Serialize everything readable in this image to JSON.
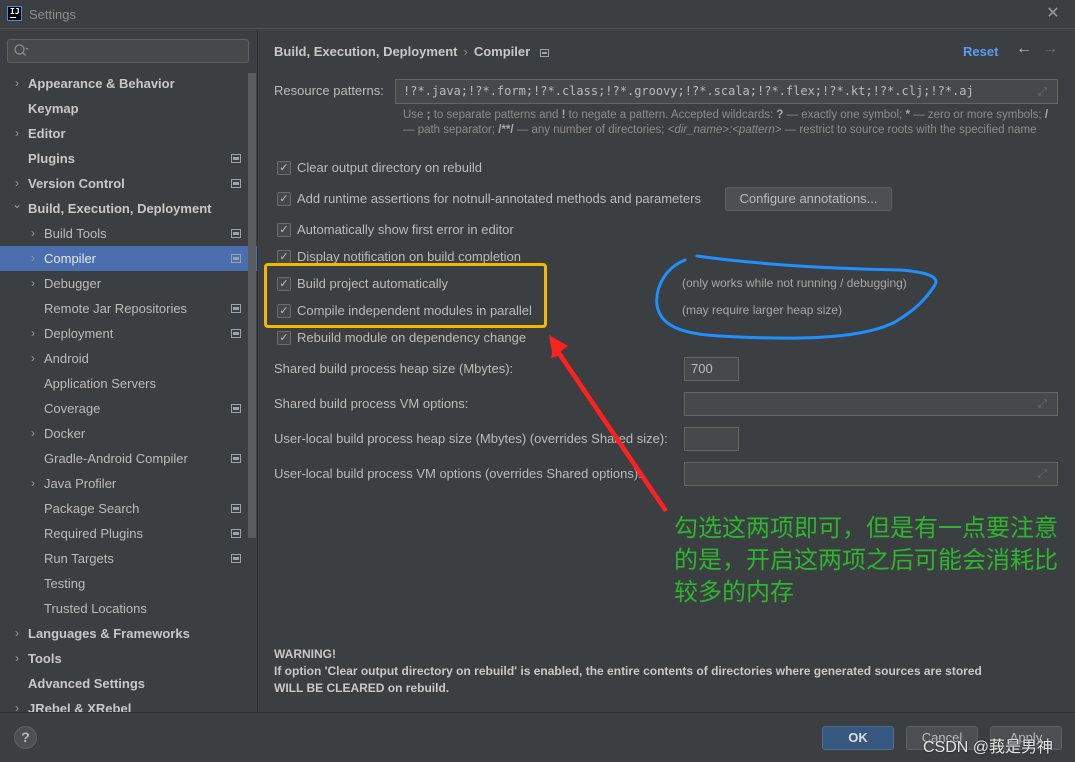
{
  "window": {
    "title": "Settings",
    "logo_text": "IJ"
  },
  "sidebar": {
    "search_placeholder": "",
    "items": [
      {
        "label": "Appearance & Behavior",
        "level": 0,
        "expandable": true,
        "expanded": false,
        "project_icon": false
      },
      {
        "label": "Keymap",
        "level": 0,
        "expandable": false,
        "project_icon": false
      },
      {
        "label": "Editor",
        "level": 0,
        "expandable": true,
        "expanded": false,
        "project_icon": false
      },
      {
        "label": "Plugins",
        "level": 0,
        "expandable": false,
        "project_icon": true
      },
      {
        "label": "Version Control",
        "level": 0,
        "expandable": true,
        "expanded": false,
        "project_icon": true
      },
      {
        "label": "Build, Execution, Deployment",
        "level": 0,
        "expandable": true,
        "expanded": true,
        "project_icon": false
      },
      {
        "label": "Build Tools",
        "level": 1,
        "expandable": true,
        "expanded": false,
        "project_icon": true
      },
      {
        "label": "Compiler",
        "level": 1,
        "expandable": true,
        "expanded": false,
        "project_icon": true,
        "selected": true
      },
      {
        "label": "Debugger",
        "level": 1,
        "expandable": true,
        "expanded": false,
        "project_icon": false
      },
      {
        "label": "Remote Jar Repositories",
        "level": 1,
        "expandable": false,
        "project_icon": true
      },
      {
        "label": "Deployment",
        "level": 1,
        "expandable": true,
        "expanded": false,
        "project_icon": true
      },
      {
        "label": "Android",
        "level": 1,
        "expandable": true,
        "expanded": false,
        "project_icon": false
      },
      {
        "label": "Application Servers",
        "level": 1,
        "expandable": false,
        "project_icon": false
      },
      {
        "label": "Coverage",
        "level": 1,
        "expandable": false,
        "project_icon": true
      },
      {
        "label": "Docker",
        "level": 1,
        "expandable": true,
        "expanded": false,
        "project_icon": false
      },
      {
        "label": "Gradle-Android Compiler",
        "level": 1,
        "expandable": false,
        "project_icon": true
      },
      {
        "label": "Java Profiler",
        "level": 1,
        "expandable": true,
        "expanded": false,
        "project_icon": false
      },
      {
        "label": "Package Search",
        "level": 1,
        "expandable": false,
        "project_icon": true
      },
      {
        "label": "Required Plugins",
        "level": 1,
        "expandable": false,
        "project_icon": true
      },
      {
        "label": "Run Targets",
        "level": 1,
        "expandable": false,
        "project_icon": true
      },
      {
        "label": "Testing",
        "level": 1,
        "expandable": false,
        "project_icon": false
      },
      {
        "label": "Trusted Locations",
        "level": 1,
        "expandable": false,
        "project_icon": false
      },
      {
        "label": "Languages & Frameworks",
        "level": 0,
        "expandable": true,
        "expanded": false,
        "project_icon": false
      },
      {
        "label": "Tools",
        "level": 0,
        "expandable": true,
        "expanded": false,
        "project_icon": false
      },
      {
        "label": "Advanced Settings",
        "level": 0,
        "expandable": false,
        "project_icon": false
      },
      {
        "label": "JRebel & XRebel",
        "level": 0,
        "expandable": true,
        "expanded": false,
        "project_icon": false
      }
    ]
  },
  "header": {
    "breadcrumb_parent": "Build, Execution, Deployment",
    "breadcrumb_separator": "›",
    "breadcrumb_current": "Compiler",
    "reset_label": "Reset",
    "back_icon": "←",
    "forward_icon": "→"
  },
  "resource_patterns": {
    "label": "Resource patterns:",
    "value": "!?*.java;!?*.form;!?*.class;!?*.groovy;!?*.scala;!?*.flex;!?*.kt;!?*.clj;!?*.aj",
    "help_parts": {
      "p1": "Use ",
      "semi": ";",
      "p2": " to separate patterns and ",
      "bang": "!",
      "p3": " to negate a pattern. Accepted wildcards: ",
      "q": "?",
      "p4": " — exactly one symbol; ",
      "star": "*",
      "p5": " — zero or more symbols; ",
      "slash": "/",
      "p6": " — path separator; ",
      "dstar": "/**/",
      "p7": " — any number of directories; ",
      "dir": "<dir_name>:<pattern>",
      "p8": " — restrict to source roots with the specified name"
    }
  },
  "checkboxes": [
    {
      "label": "Clear output directory on rebuild",
      "checked": true
    },
    {
      "label": "Add runtime assertions for notnull-annotated methods and parameters",
      "checked": true
    },
    {
      "label": "Automatically show first error in editor",
      "checked": true
    },
    {
      "label": "Display notification on build completion",
      "checked": true
    },
    {
      "label": "Build project automatically",
      "checked": true
    },
    {
      "label": "Compile independent modules in parallel",
      "checked": true
    },
    {
      "label": "Rebuild module on dependency change",
      "checked": true
    }
  ],
  "configure_annotations_label": "Configure annotations...",
  "hints": {
    "build_auto": "(only works while not running / debugging)",
    "parallel": "(may require larger heap size)"
  },
  "fields": {
    "shared_heap_label": "Shared build process heap size (Mbytes):",
    "shared_heap_value": "700",
    "shared_vm_label": "Shared build process VM options:",
    "shared_vm_value": "",
    "local_heap_label": "User-local build process heap size (Mbytes) (overrides Shared size):",
    "local_heap_value": "",
    "local_vm_label": "User-local build process VM options (overrides Shared options):",
    "local_vm_value": ""
  },
  "warning": {
    "title": "WARNING!",
    "line1": "If option 'Clear output directory on rebuild' is enabled, the entire contents of directories where generated sources are stored",
    "line2": "WILL BE CLEARED on rebuild."
  },
  "annotation": {
    "note": "勾选这两项即可，但是有一点要注意的是，开启这两项之后可能会消耗比较多的内存",
    "box_color": "#f5b800",
    "arrow_color": "#ff2020",
    "circle_color": "#1e90ff",
    "text_color": "#2db52d"
  },
  "footer": {
    "help_label": "?",
    "ok_label": "OK",
    "cancel_label": "Cancel",
    "apply_label": "Apply",
    "watermark": "CSDN @莪是男神"
  }
}
